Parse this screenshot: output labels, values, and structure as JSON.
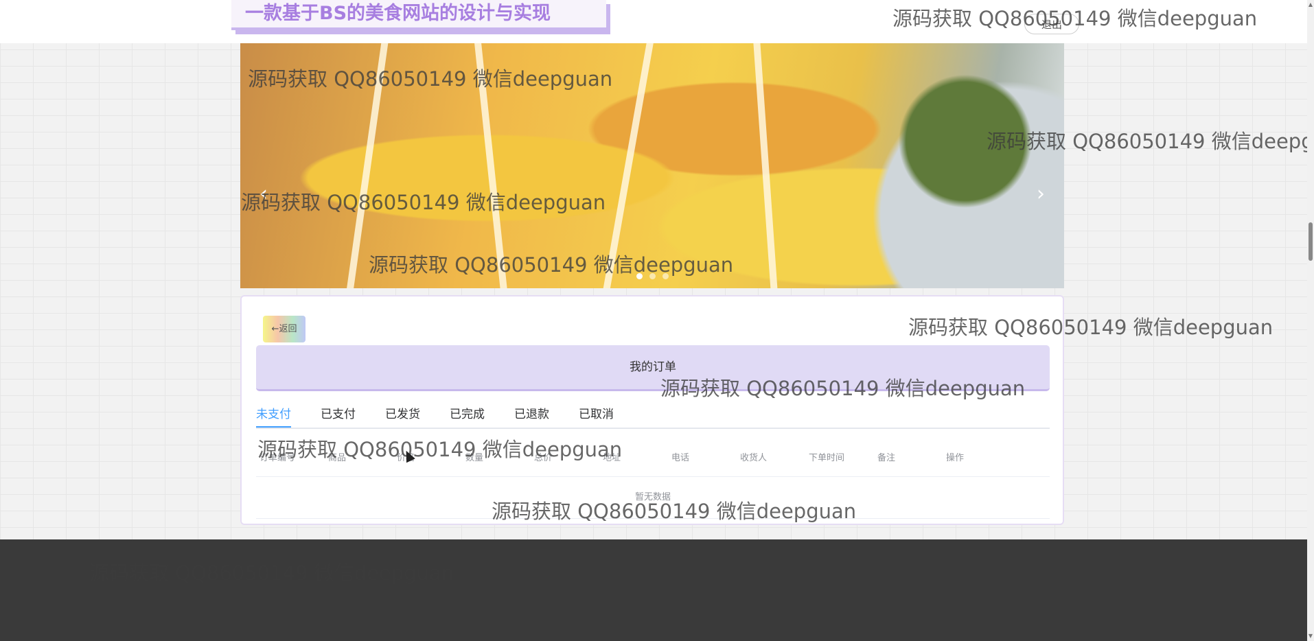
{
  "header": {
    "site_title": "一款基于BS的美食网站的设计与实现",
    "logout_label": "退出"
  },
  "carousel": {
    "prev_icon": "‹",
    "next_icon": "›"
  },
  "orders": {
    "back_label": "←返回",
    "heading": "我的订单",
    "tabs": [
      "未支付",
      "已支付",
      "已发货",
      "已完成",
      "已退款",
      "已取消"
    ],
    "active_tab": "未支付",
    "columns": [
      "订单编号",
      "商品",
      "价格",
      "数量",
      "总价",
      "地址",
      "电话",
      "收货人",
      "下单时间",
      "备注",
      "操作"
    ],
    "empty_text": "暂无数据"
  },
  "watermark": "源码获取 QQ86050149 微信deepguan",
  "colors": {
    "accent": "#409eff",
    "title_purple": "#a77ee0",
    "footer": "#3a3a3a"
  }
}
